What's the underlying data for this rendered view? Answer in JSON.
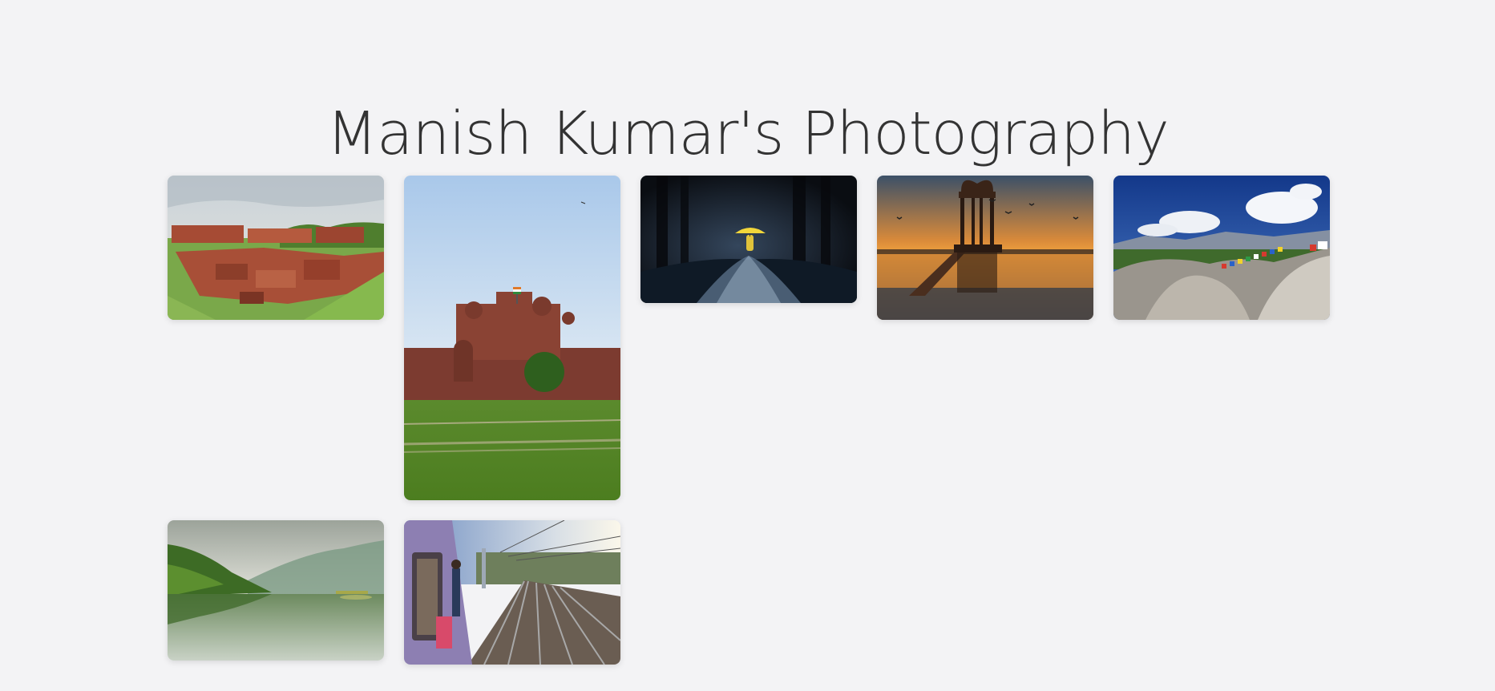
{
  "page": {
    "title": "Manish Kumar's Photography"
  },
  "gallery": {
    "photos": [
      {
        "subject": "brick ruins on green lawn"
      },
      {
        "subject": "red fort with flag and lawn"
      },
      {
        "subject": "person with yellow umbrella on snowy forest road"
      },
      {
        "subject": "lake pavilion silhouette at sunset"
      },
      {
        "subject": "rocky hill with prayer flags and mountains"
      },
      {
        "subject": "misty mountain lake reflection"
      },
      {
        "subject": "commuter train and railway tracks"
      }
    ]
  },
  "colors": {
    "background": "#f3f3f5",
    "title": "#333333"
  }
}
